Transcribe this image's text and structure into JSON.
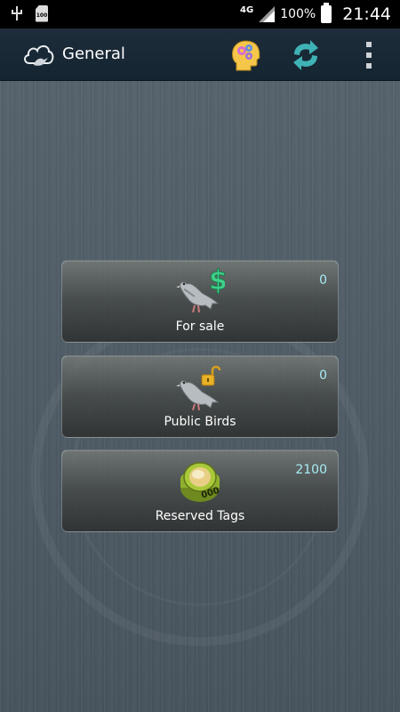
{
  "status_bar": {
    "network": "4G",
    "battery_percent": "100%",
    "time": "21:44",
    "sd_label": "100"
  },
  "action_bar": {
    "title": "General"
  },
  "cards": [
    {
      "label": "For sale",
      "count": "0",
      "icon": "pigeon-dollar-icon"
    },
    {
      "label": "Public Birds",
      "count": "0",
      "icon": "pigeon-unlock-icon"
    },
    {
      "label": "Reserved Tags",
      "count": "2100",
      "icon": "leg-ring-icon"
    }
  ],
  "colors": {
    "action_bar_bg": "#1e2d3a",
    "count_text": "#a8ecf5",
    "background": "#4f5c66"
  }
}
